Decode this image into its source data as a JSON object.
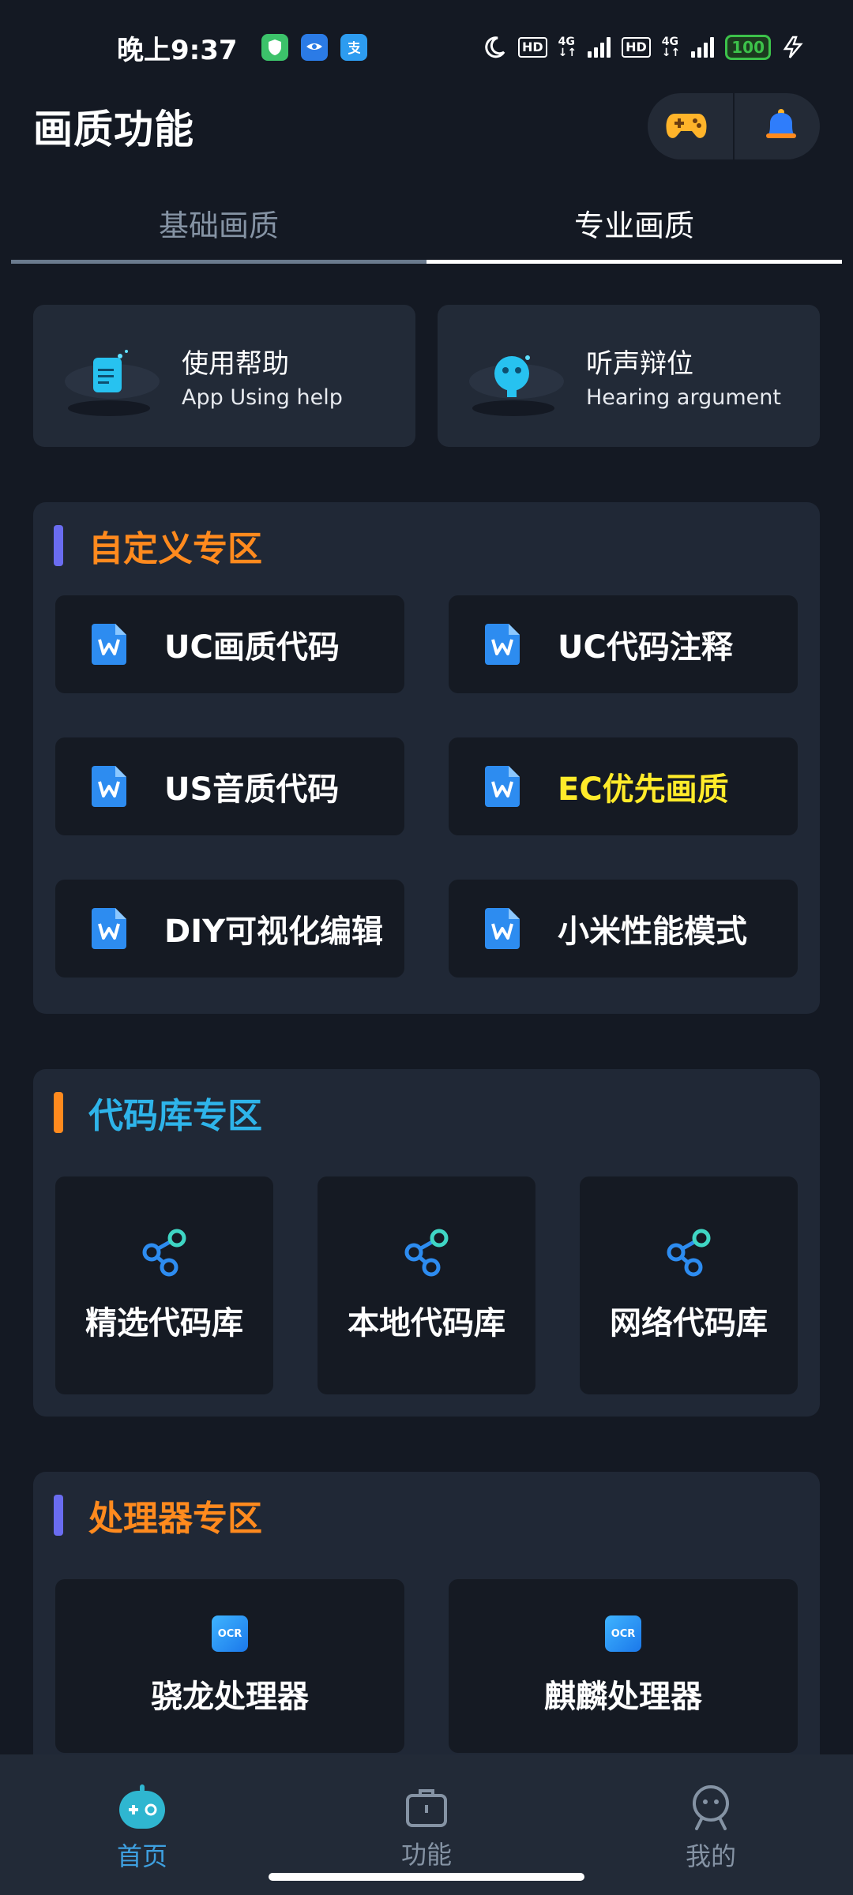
{
  "status_bar": {
    "time": "晚上9:37",
    "hd1": "HD",
    "net1": "4G",
    "hd2": "HD",
    "net2": "4G",
    "battery": "100"
  },
  "header": {
    "title": "画质功能",
    "actions": [
      "gamepad-icon",
      "bell-icon"
    ]
  },
  "tabs": [
    {
      "label": "基础画质",
      "active": false
    },
    {
      "label": "专业画质",
      "active": true
    }
  ],
  "help_cards": [
    {
      "title": "使用帮助",
      "subtitle": "App Using help"
    },
    {
      "title": "听声辩位",
      "subtitle": "Hearing argument"
    }
  ],
  "sections": {
    "custom": {
      "title": "自定义专区",
      "title_color": "#ff8a1e",
      "bar_color": "#6a6cf0",
      "items": [
        {
          "label": "UC画质代码",
          "color": "#ffffff"
        },
        {
          "label": "UC代码注释",
          "color": "#ffffff"
        },
        {
          "label": "US音质代码",
          "color": "#ffffff"
        },
        {
          "label": "EC优先画质",
          "color": "#ffeb2a"
        },
        {
          "label": "DIY可视化编辑",
          "color": "#ffffff"
        },
        {
          "label": "小米性能模式",
          "color": "#ffffff"
        }
      ]
    },
    "library": {
      "title": "代码库专区",
      "title_color": "#2eb4ea",
      "bar_color": "#ff8a1e",
      "items": [
        "精选代码库",
        "本地代码库",
        "网络代码库"
      ]
    },
    "processor": {
      "title": "处理器专区",
      "title_color": "#ff8a1e",
      "bar_color": "#6a6cf0",
      "icon_text": "OCR",
      "items": [
        "骁龙处理器",
        "麒麟处理器"
      ]
    }
  },
  "bottom_nav": [
    {
      "label": "首页",
      "icon": "robot-icon",
      "active": true
    },
    {
      "label": "功能",
      "icon": "briefcase-icon",
      "active": false
    },
    {
      "label": "我的",
      "icon": "user-icon",
      "active": false
    }
  ],
  "colors": {
    "background": "#141923",
    "card": "#202836",
    "tile": "#151a23",
    "accent_blue": "#3ea0e0"
  }
}
